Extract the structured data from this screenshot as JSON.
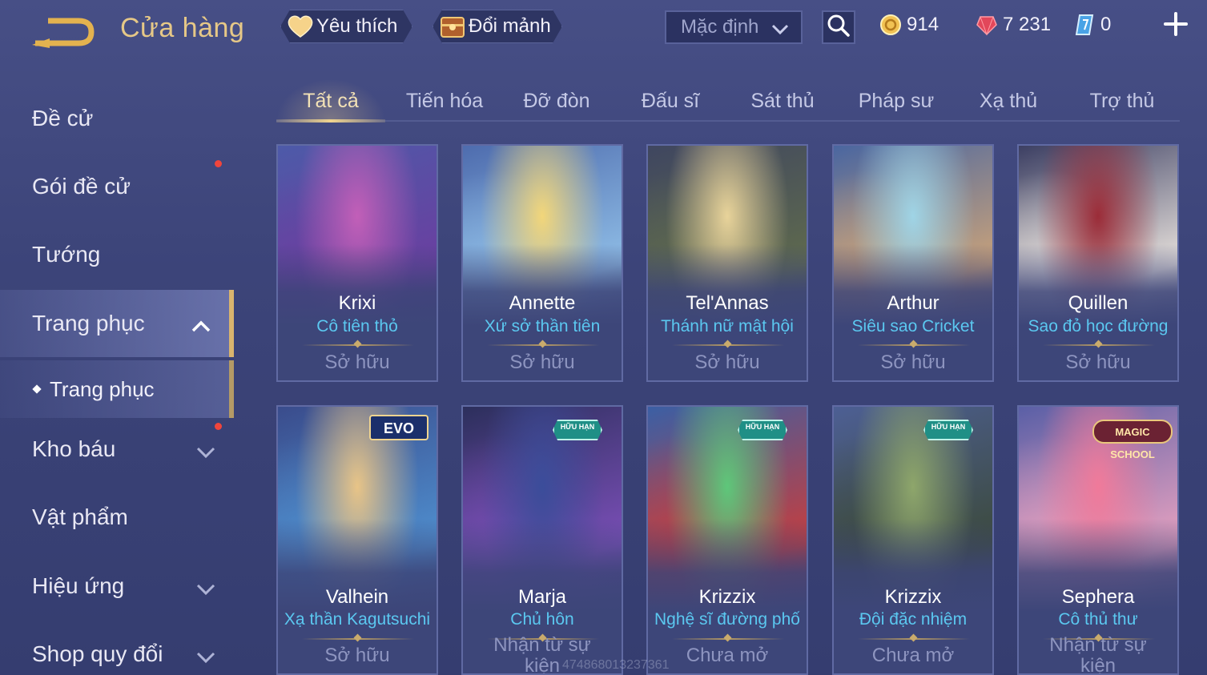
{
  "header": {
    "title": "Cửa hàng",
    "favorites_label": "Yêu thích",
    "exchange_label": "Đổi mảnh",
    "sort_label": "Mặc định",
    "currencies": [
      {
        "name": "gold-coin",
        "value": "914"
      },
      {
        "name": "red-gem",
        "value": "7 231"
      },
      {
        "name": "blue-voucher",
        "value": "0"
      }
    ]
  },
  "sidebar": {
    "items": [
      {
        "label": "Đề cử"
      },
      {
        "label": "Gói đề cử"
      },
      {
        "label": "Tướng"
      },
      {
        "label": "Trang phục"
      },
      {
        "label": "Trang phục"
      },
      {
        "label": "Kho báu"
      },
      {
        "label": "Vật phẩm"
      },
      {
        "label": "Hiệu ứng"
      },
      {
        "label": "Shop quy đổi"
      }
    ]
  },
  "tabs": [
    {
      "label": "Tất cả"
    },
    {
      "label": "Tiến hóa"
    },
    {
      "label": "Đỡ đòn"
    },
    {
      "label": "Đấu sĩ"
    },
    {
      "label": "Sát thủ"
    },
    {
      "label": "Pháp sư"
    },
    {
      "label": "Xạ thủ"
    },
    {
      "label": "Trợ thủ"
    }
  ],
  "cards": [
    {
      "hero": "Krixi",
      "skin": "Cô tiên thỏ",
      "status": "Sở hữu",
      "badge": "",
      "colors": [
        "#c25fb8",
        "#6a3fa0",
        "#4d5aa8"
      ]
    },
    {
      "hero": "Annette",
      "skin": "Xứ sở thần tiên",
      "status": "Sở hữu",
      "badge": "",
      "colors": [
        "#f2d67a",
        "#8fbde6",
        "#4e6cae"
      ]
    },
    {
      "hero": "Tel'Annas",
      "skin": "Thánh nữ mật hội",
      "status": "Sở hữu",
      "badge": "",
      "colors": [
        "#e8d39a",
        "#5f6a4d",
        "#3f4660"
      ]
    },
    {
      "hero": "Arthur",
      "skin": "Siêu sao Cricket",
      "status": "Sở hữu",
      "badge": "",
      "colors": [
        "#9fd4e6",
        "#c9a27a",
        "#4a66a0"
      ]
    },
    {
      "hero": "Quillen",
      "skin": "Sao đỏ học đường",
      "status": "Sở hữu",
      "badge": "",
      "colors": [
        "#9b2c38",
        "#e7e1dc",
        "#3c3f63"
      ]
    },
    {
      "hero": "Valhein",
      "skin": "Xạ thần Kagutsuchi",
      "status": "Sở hữu",
      "badge": "EVO",
      "colors": [
        "#e8c487",
        "#4f8fcf",
        "#3a4c8c"
      ]
    },
    {
      "hero": "Marja",
      "skin": "Chủ hôn",
      "status": "Nhận từ sự kiện",
      "badge": "HỮU HẠN",
      "colors": [
        "#3b4d9a",
        "#7b4fb8",
        "#2c2f5c"
      ]
    },
    {
      "hero": "Krizzix",
      "skin": "Nghệ sĩ đường phố",
      "status": "Chưa mở",
      "badge": "HỮU HẠN",
      "colors": [
        "#5ec77a",
        "#c63e3e",
        "#3b5fa4"
      ]
    },
    {
      "hero": "Krizzix",
      "skin": "Đội đặc nhiệm",
      "status": "Chưa mở",
      "badge": "HỮU HẠN",
      "colors": [
        "#8ea66b",
        "#3c4a3c",
        "#4d5f94"
      ]
    },
    {
      "hero": "Sephera",
      "skin": "Cô thủ thư",
      "status": "Nhận từ sự kiện",
      "badge": "MAGIC SCHOOL",
      "colors": [
        "#f07a9a",
        "#e8a2c0",
        "#5a5fa6"
      ]
    }
  ],
  "watermark": "474868013237361",
  "colors": {
    "accent_gold": "#e6c887",
    "skin_name": "#5bc8f0",
    "status_text": "#8e95c0"
  }
}
